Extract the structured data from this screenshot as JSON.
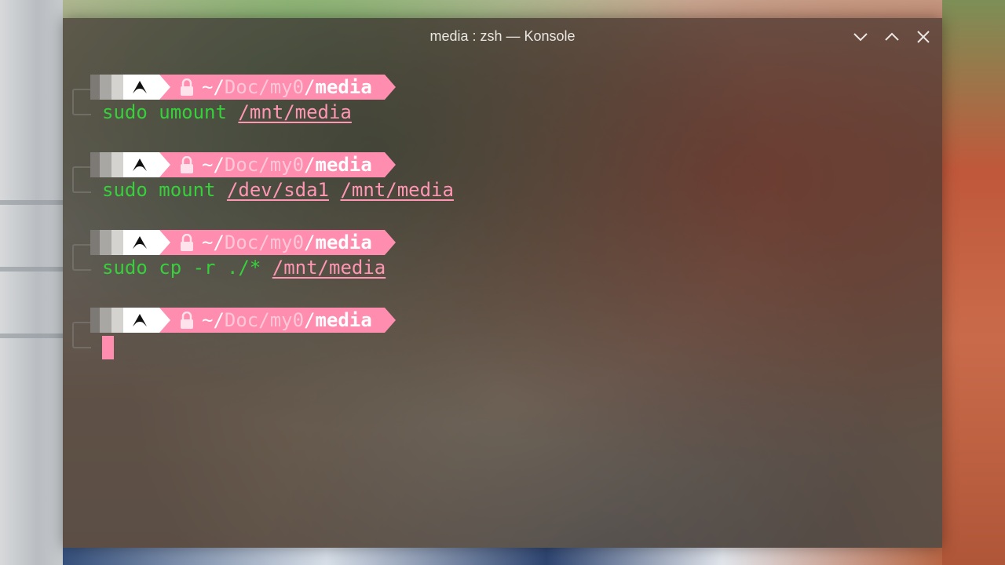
{
  "window": {
    "title": "media : zsh — Konsole",
    "controls": [
      "minimize",
      "maximize",
      "close"
    ]
  },
  "prompt": {
    "os_icon": "arch-linux-icon",
    "lock_icon": "lock-icon",
    "home": "~/",
    "dir1": "Doc",
    "sep1": "/",
    "dir2": "my0",
    "sep2": "/",
    "current": "media",
    "color": "#ff8db0"
  },
  "history": [
    {
      "parts": [
        {
          "t": "sudo umount ",
          "c": "kw"
        },
        {
          "t": "/mnt/media",
          "c": "path"
        }
      ]
    },
    {
      "parts": [
        {
          "t": "sudo mount ",
          "c": "kw"
        },
        {
          "t": "/dev/sda1",
          "c": "path"
        },
        {
          "t": " ",
          "c": "kw"
        },
        {
          "t": "/mnt/media",
          "c": "path"
        }
      ]
    },
    {
      "parts": [
        {
          "t": "sudo cp -r ./* ",
          "c": "kw"
        },
        {
          "t": "/mnt/media",
          "c": "path"
        }
      ]
    }
  ],
  "colors": {
    "command": "#36d13a",
    "path": "#ff96b4",
    "cursor": "#ff8db0"
  }
}
